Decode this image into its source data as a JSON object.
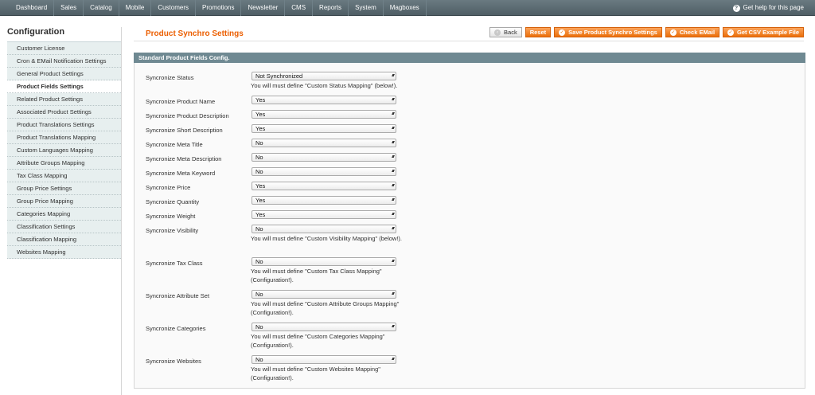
{
  "nav": {
    "items": [
      "Dashboard",
      "Sales",
      "Catalog",
      "Mobile",
      "Customers",
      "Promotions",
      "Newsletter",
      "CMS",
      "Reports",
      "System",
      "Magboxes"
    ],
    "help": "Get help for this page"
  },
  "sidebar": {
    "title": "Configuration",
    "items": [
      "Customer License",
      "Cron & EMail Notification Settings",
      "General Product Settings",
      "Product Fields Settings",
      "Related Product Settings",
      "Associated Product Settings",
      "Product Translations Settings",
      "Product Translations Mapping",
      "Custom Languages Mapping",
      "Attribute Groups Mapping",
      "Tax Class Mapping",
      "Group Price Settings",
      "Group Price Mapping",
      "Categories Mapping",
      "Classification Settings",
      "Classification Mapping",
      "Websites Mapping"
    ],
    "active_index": 3
  },
  "header": {
    "title": "Product Synchro Settings",
    "buttons": {
      "back": "Back",
      "reset": "Reset",
      "save": "Save Product Synchro Settings",
      "check_email": "Check EMail",
      "csv": "Get CSV Example File"
    }
  },
  "fieldset": {
    "title": "Standard Product Fields Config.",
    "rows": [
      {
        "label": "Syncronize Status",
        "value": "Not Synchronized",
        "note": "You will must define \"Custom Status Mapping\" (below!)."
      },
      {
        "label": "Syncronize Product Name",
        "value": "Yes"
      },
      {
        "label": "Syncronize Product Description",
        "value": "Yes"
      },
      {
        "label": "Syncronize Short Description",
        "value": "Yes"
      },
      {
        "label": "Syncronize Meta Title",
        "value": "No"
      },
      {
        "label": "Syncronize Meta Description",
        "value": "No"
      },
      {
        "label": "Syncronize Meta Keyword",
        "value": "No"
      },
      {
        "label": "Syncronize Price",
        "value": "Yes"
      },
      {
        "label": "Syncronize Quantity",
        "value": "Yes"
      },
      {
        "label": "Syncronize Weight",
        "value": "Yes"
      },
      {
        "label": "Syncronize Visibility",
        "value": "No",
        "note": "You will must define \"Custom Visibility Mapping\" (below!)."
      },
      {
        "label": "Syncronize Tax Class",
        "value": "No",
        "note": "You will must define \"Custom Tax Class Mapping\" (Configuration!)."
      },
      {
        "label": "Syncronize Attribute Set",
        "value": "No",
        "note": "You will must define \"Custom Attribute Groups Mapping\" (Configuration!)."
      },
      {
        "label": "Syncronize Categories",
        "value": "No",
        "note": "You will must define \"Custom Categories Mapping\" (Configuration!)."
      },
      {
        "label": "Syncronize Websites",
        "value": "No",
        "note": "You will must define \"Custom Websites Mapping\" (Configuration!)."
      }
    ]
  }
}
